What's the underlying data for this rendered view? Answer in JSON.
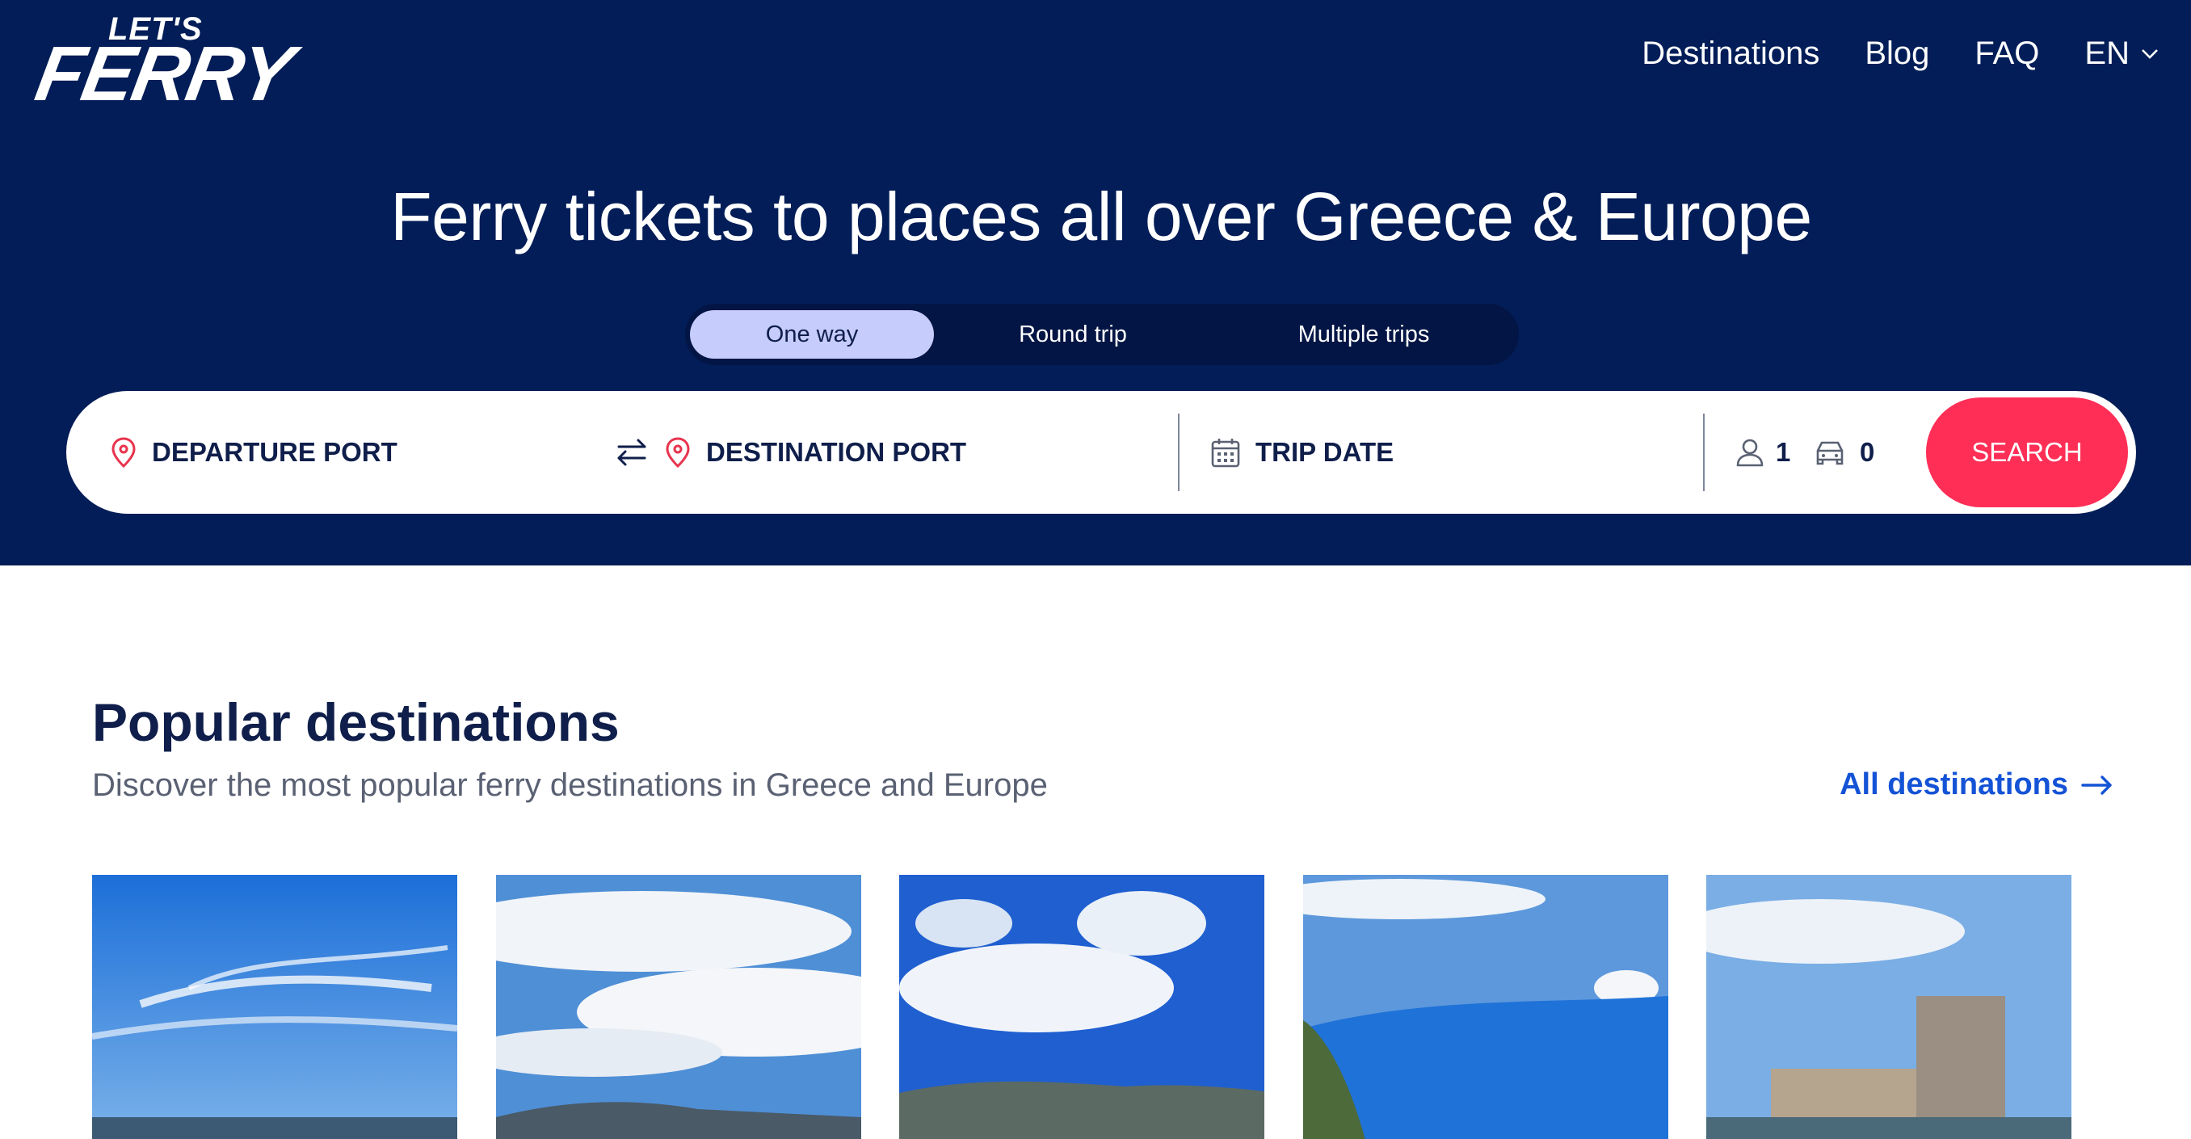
{
  "brand": {
    "logo_top": "LET'S",
    "logo_main": "FERRY"
  },
  "nav": {
    "items": [
      "Destinations",
      "Blog",
      "FAQ"
    ],
    "language": "EN"
  },
  "hero": {
    "headline": "Ferry tickets to places all over Greece & Europe"
  },
  "trip_type": {
    "tabs": [
      "One way",
      "Round trip",
      "Multiple trips"
    ],
    "selected": "One way"
  },
  "search": {
    "departure_label": "DEPARTURE PORT",
    "destination_label": "DESTINATION PORT",
    "date_label": "TRIP DATE",
    "passengers": "1",
    "vehicles": "0",
    "button_label": "SEARCH"
  },
  "popular": {
    "title": "Popular destinations",
    "subtitle": "Discover the most popular ferry destinations in Greece and Europe",
    "all_link": "All destinations"
  },
  "colors": {
    "hero_bg": "#021d57",
    "accent": "#fe2e56",
    "link": "#1453d6",
    "tab_active": "#c6ccfb"
  },
  "icons": [
    "location-pin-icon",
    "swap-arrows-icon",
    "calendar-icon",
    "person-icon",
    "car-icon",
    "chevron-down-icon",
    "arrow-right-icon"
  ]
}
